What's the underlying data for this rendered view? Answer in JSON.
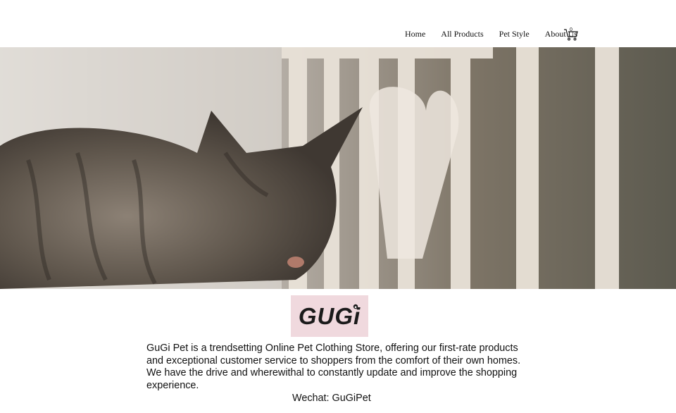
{
  "nav": {
    "items": [
      "Home",
      "All Products",
      "Pet Style",
      "About Us"
    ],
    "cart_count": "0"
  },
  "hero": {
    "image": "tabby-cat-on-railing"
  },
  "logo": {
    "text": "GUGi"
  },
  "about": {
    "description": "GuGi Pet is a trendsetting Online Pet Clothing Store, offering our first-rate products and exceptional customer service to shoppers from the comfort of their own homes. We have the drive and wherewithal to constantly update and improve the shopping experience.",
    "wechat": "Wechat: GuGiPet"
  },
  "colors": {
    "logo_bg": "#f0d9de",
    "text": "#111111"
  }
}
